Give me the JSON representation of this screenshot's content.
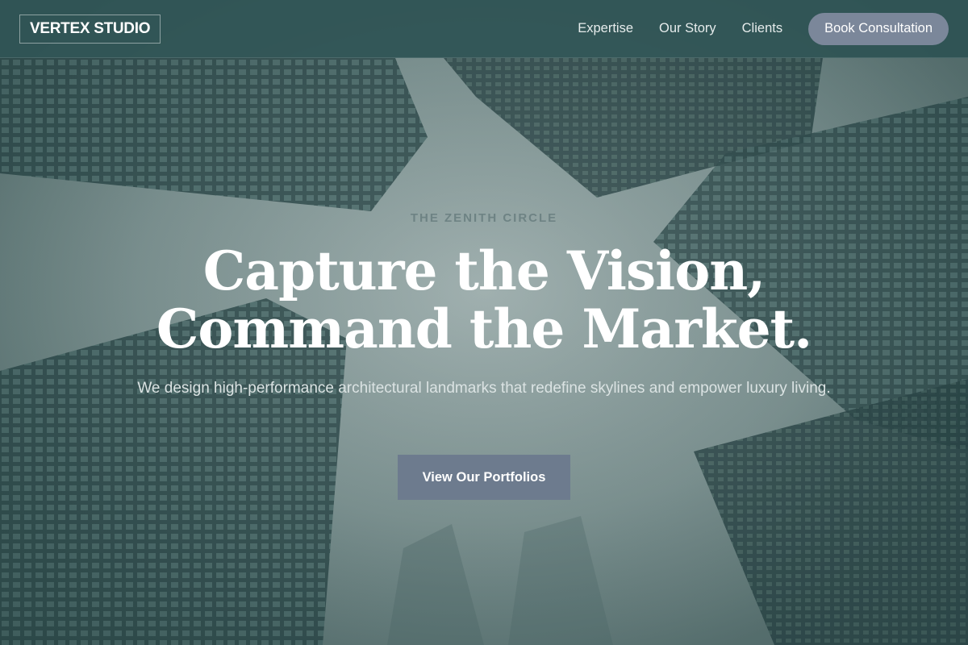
{
  "header": {
    "logo": "VERTEX STUDIO",
    "nav": [
      {
        "label": "Expertise"
      },
      {
        "label": "Our Story"
      },
      {
        "label": "Clients"
      }
    ],
    "cta_label": "Book Consultation"
  },
  "hero": {
    "eyebrow": "THE ZENITH CIRCLE",
    "headline_line1": "Capture the Vision,",
    "headline_line2": "Command the Market.",
    "subtext": "We design high-performance architectural landmarks that redefine skylines and empower luxury living.",
    "button_label": "View Our Portfolios"
  },
  "colors": {
    "header_bg": "#2e5254",
    "cta_bg": "#7b879a",
    "primary_button_bg": "#6d7b8e",
    "sky": "#8fa2a2"
  }
}
